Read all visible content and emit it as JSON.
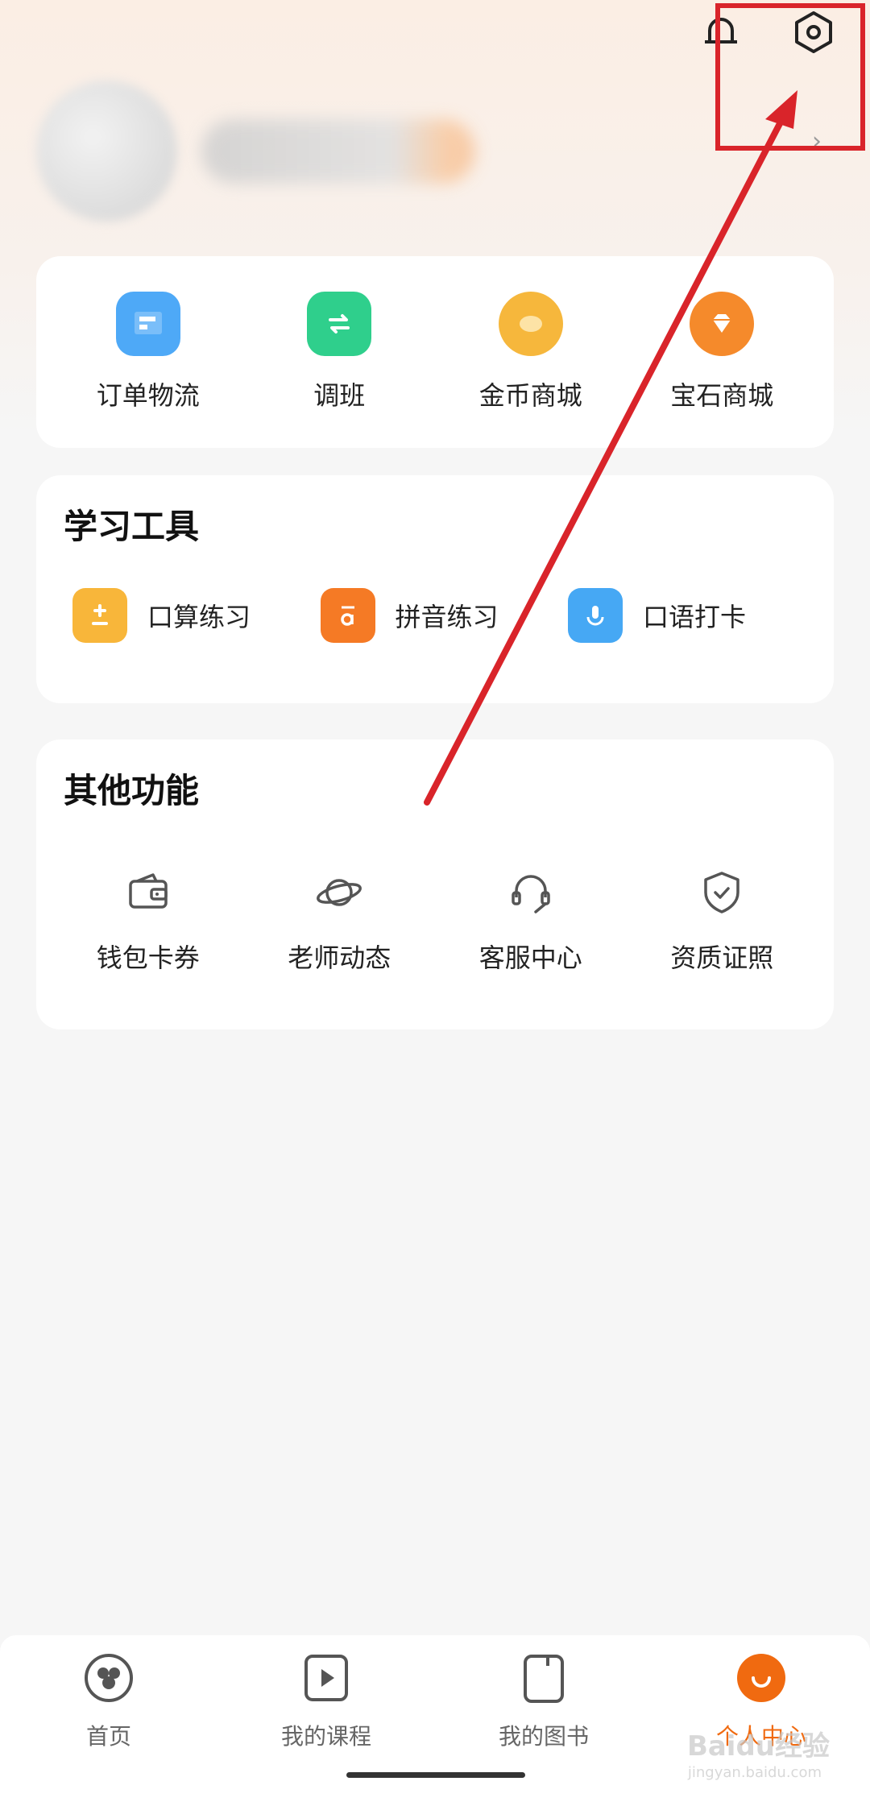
{
  "header": {
    "icons": [
      "bell-icon",
      "settings-hexagon-icon"
    ]
  },
  "quick_actions": [
    {
      "label": "订单物流",
      "icon": "order-logistics-icon",
      "color": "#4ea9f7"
    },
    {
      "label": "调班",
      "icon": "switch-class-icon",
      "color": "#2fcf8c"
    },
    {
      "label": "金币商城",
      "icon": "gold-coin-icon",
      "color": "#f6b73c"
    },
    {
      "label": "宝石商城",
      "icon": "gem-icon",
      "color": "#f58a2b"
    }
  ],
  "tools": {
    "title": "学习工具",
    "items": [
      {
        "label": "口算练习",
        "icon": "plus-minus-icon",
        "color": "#f8b63a"
      },
      {
        "label": "拼音练习",
        "icon": "pinyin-a-icon",
        "color": "#f57a25"
      },
      {
        "label": "口语打卡",
        "icon": "microphone-icon",
        "color": "#46a8f4"
      }
    ]
  },
  "other": {
    "title": "其他功能",
    "items": [
      {
        "label": "钱包卡券",
        "icon": "wallet-icon"
      },
      {
        "label": "老师动态",
        "icon": "planet-icon"
      },
      {
        "label": "客服中心",
        "icon": "headset-icon"
      },
      {
        "label": "资质证照",
        "icon": "shield-check-icon"
      }
    ]
  },
  "tabbar": {
    "items": [
      {
        "label": "首页",
        "icon": "home-icon",
        "active": false
      },
      {
        "label": "我的课程",
        "icon": "play-course-icon",
        "active": false
      },
      {
        "label": "我的图书",
        "icon": "book-icon",
        "active": false
      },
      {
        "label": "个人中心",
        "icon": "smile-profile-icon",
        "active": true
      }
    ],
    "active_color": "#f06a10"
  },
  "watermark": {
    "text": "Baidu经验",
    "sub": "jingyan.baidu.com"
  }
}
